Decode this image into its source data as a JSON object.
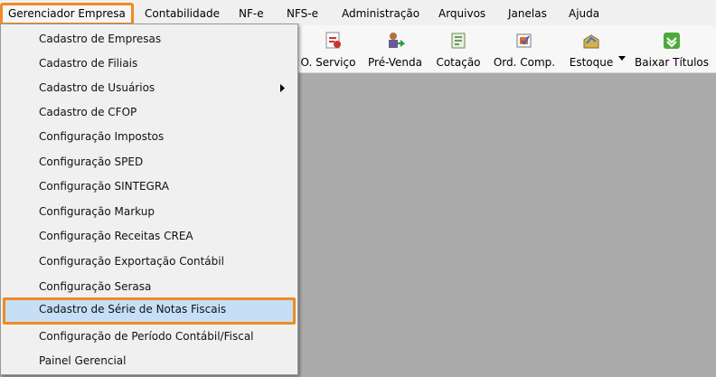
{
  "menubar": {
    "items": [
      {
        "label": "Gerenciador Empresa"
      },
      {
        "label": "Contabilidade"
      },
      {
        "label": "NF-e"
      },
      {
        "label": "NFS-e"
      },
      {
        "label": "Administração"
      },
      {
        "label": "Arquivos"
      },
      {
        "label": "Janelas"
      },
      {
        "label": "Ajuda"
      }
    ]
  },
  "toolbar": {
    "buttons": [
      {
        "label": "O. Serviço",
        "icon": "service-order-icon"
      },
      {
        "label": "Pré-Venda",
        "icon": "pre-sale-icon"
      },
      {
        "label": "Cotação",
        "icon": "quotation-icon"
      },
      {
        "label": "Ord. Comp.",
        "icon": "purchase-order-icon"
      },
      {
        "label": "Estoque",
        "icon": "stock-icon"
      },
      {
        "label": "Baixar Títulos",
        "icon": "checkmark-icon"
      }
    ]
  },
  "dropdown": {
    "items": [
      {
        "label": "Cadastro de Empresas"
      },
      {
        "label": "Cadastro de Filiais"
      },
      {
        "label": "Cadastro de Usuários"
      },
      {
        "label": "Cadastro de CFOP"
      },
      {
        "label": "Configuração Impostos"
      },
      {
        "label": "Configuração SPED"
      },
      {
        "label": "Configuração SINTEGRA"
      },
      {
        "label": "Configuração Markup"
      },
      {
        "label": "Configuração Receitas CREA"
      },
      {
        "label": "Configuração Exportação Contábil"
      },
      {
        "label": "Configuração Serasa"
      },
      {
        "label": "Cadastro de Série de Notas Fiscais"
      },
      {
        "label": "Configuração de Período Contábil/Fiscal"
      },
      {
        "label": "Painel Gerencial"
      }
    ]
  },
  "colors": {
    "highlight_border": "#f08a24",
    "highlight_fill": "#c6dff6",
    "workspace": "#ababab"
  }
}
